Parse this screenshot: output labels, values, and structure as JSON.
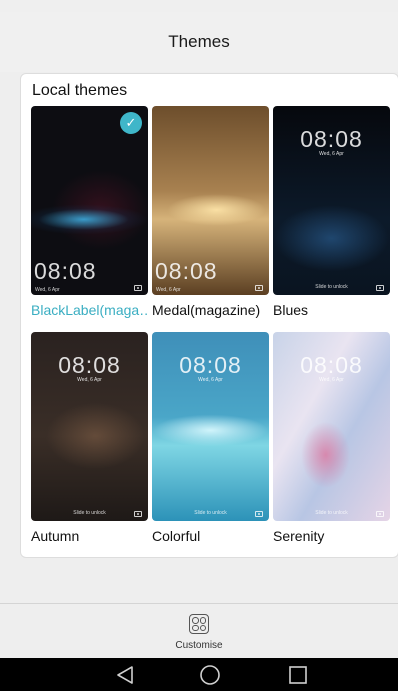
{
  "header": {
    "title": "Themes"
  },
  "local_themes": {
    "section_title": "Local themes",
    "items": [
      {
        "label": "BlackLabel(maga…",
        "selected": true,
        "clock": "08:08",
        "date": "Wed, 6 Apr"
      },
      {
        "label": "Medal(magazine)",
        "selected": false,
        "clock": "08:08",
        "date": "Wed, 6 Apr"
      },
      {
        "label": "Blues",
        "selected": false,
        "clock": "08:08",
        "date": "Wed, 6 Apr",
        "unlock": "Slide to unlock"
      },
      {
        "label": "Autumn",
        "selected": false,
        "clock": "08:08",
        "date": "Wed, 6 Apr",
        "unlock": "Slide to unlock"
      },
      {
        "label": "Colorful",
        "selected": false,
        "clock": "08:08",
        "date": "Wed, 6 Apr",
        "unlock": "Slide to unlock"
      },
      {
        "label": "Serenity",
        "selected": false,
        "clock": "08:08",
        "date": "Wed, 6 Apr",
        "unlock": "Slide to unlock"
      }
    ]
  },
  "bottom": {
    "customise_label": "Customise"
  },
  "colors": {
    "accent": "#3aaec2",
    "check_badge": "#3fb6c9"
  },
  "icons": {
    "selected": "checkmark-icon",
    "camera": "camera-icon",
    "customise": "customise-grid-icon",
    "nav": [
      "back-icon",
      "home-icon",
      "recents-icon"
    ]
  }
}
